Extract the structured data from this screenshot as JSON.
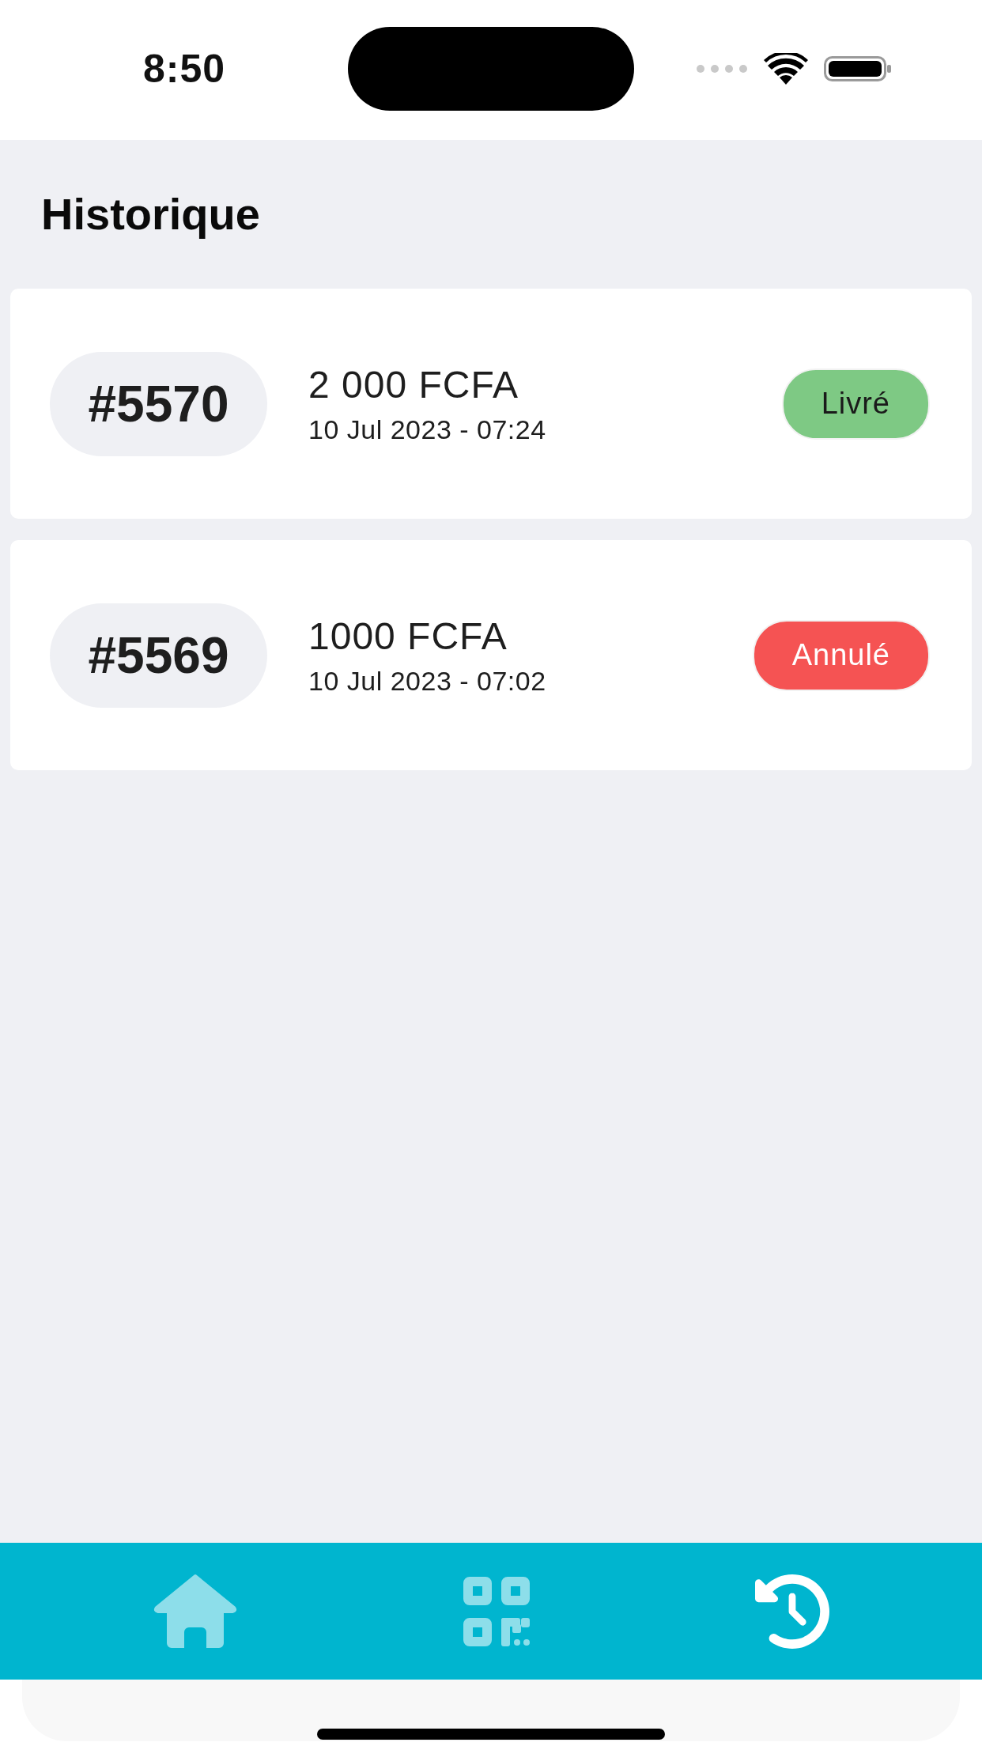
{
  "status_bar": {
    "time": "8:50"
  },
  "header": {
    "title": "Historique"
  },
  "orders": [
    {
      "number": "#5570",
      "amount": "2 000 FCFA",
      "date": "10 Jul 2023 - 07:24",
      "status": {
        "label": "Livré",
        "color": "#7ec984"
      }
    },
    {
      "number": "#5569",
      "amount": "1000 FCFA",
      "date": "10 Jul 2023 - 07:02",
      "status": {
        "label": "Annulé",
        "color": "#f55353"
      }
    }
  ],
  "tab_bar": {
    "tabs": [
      {
        "kind": "home",
        "selected": false
      },
      {
        "kind": "qr",
        "selected": false
      },
      {
        "kind": "history",
        "selected": true
      }
    ]
  }
}
